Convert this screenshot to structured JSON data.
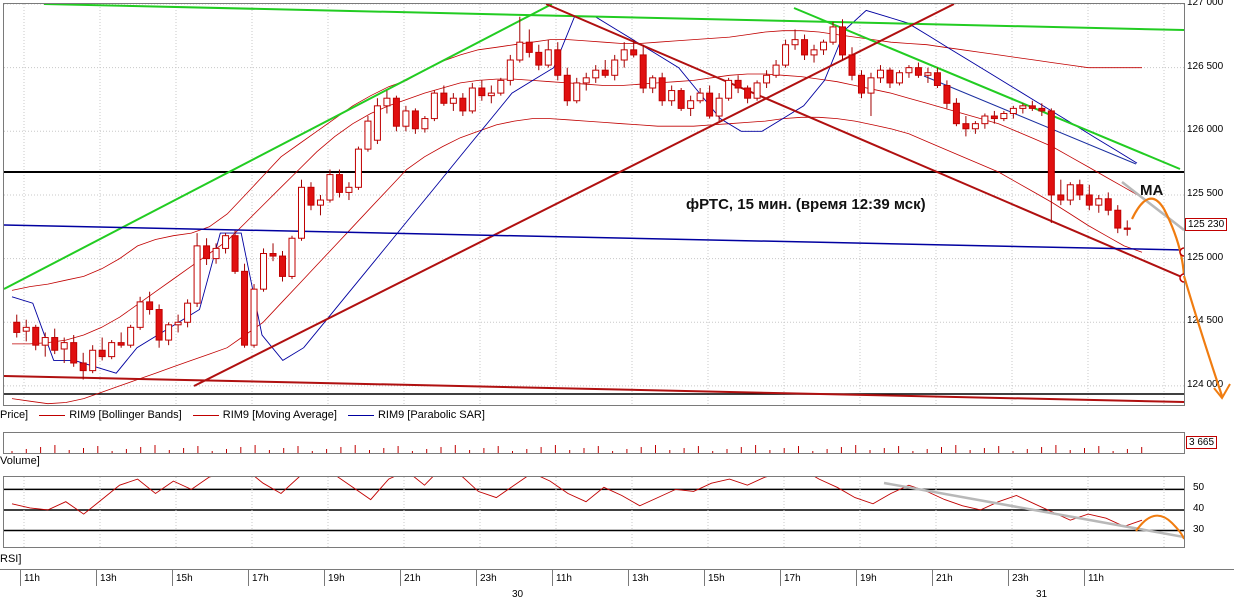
{
  "chart_data": {
    "type": "candlestick",
    "title": "фРТС,  15 мин. (время  12:39 мск)",
    "annotation_ma": "MA",
    "price_axis": {
      "ylim": [
        123850,
        127000
      ],
      "ticks": [
        "127 000",
        "126 500",
        "126 000",
        "125 500",
        "125 000",
        "124 500",
        "124 000"
      ],
      "tick_values": [
        127000,
        126500,
        126000,
        125500,
        125000,
        124500,
        124000
      ],
      "last_price_label": "125 230",
      "last_price": 125230
    },
    "legend": {
      "price": "Price]",
      "bollinger": "RIM9 [Bollinger Bands]",
      "ma": "RIM9 [Moving Average]",
      "sar": "RIM9 [Parabolic SAR]"
    },
    "volume": {
      "title": "Volume]",
      "last_label": "3 665"
    },
    "rsi": {
      "title": "RSI]",
      "ticks": [
        "50",
        "40",
        "30"
      ],
      "tick_values": [
        50,
        40,
        30
      ],
      "ylim": [
        22,
        56
      ]
    },
    "time_axis": {
      "hour_labels": [
        "11h",
        "13h",
        "15h",
        "17h",
        "19h",
        "21h",
        "23h",
        "11h",
        "13h",
        "15h",
        "17h",
        "19h",
        "21h",
        "23h",
        "11h"
      ],
      "date_labels": [
        "30",
        "31"
      ]
    },
    "candles": [
      [
        124500,
        124560,
        124380,
        124420
      ],
      [
        124430,
        124520,
        124350,
        124460
      ],
      [
        124460,
        124480,
        124280,
        124320
      ],
      [
        124320,
        124420,
        124230,
        124380
      ],
      [
        124380,
        124450,
        124250,
        124280
      ],
      [
        124290,
        124380,
        124180,
        124340
      ],
      [
        124340,
        124400,
        124150,
        124180
      ],
      [
        124180,
        124260,
        124050,
        124120
      ],
      [
        124120,
        124320,
        124100,
        124280
      ],
      [
        124280,
        124380,
        124200,
        124230
      ],
      [
        124230,
        124360,
        124210,
        124340
      ],
      [
        124340,
        124420,
        124300,
        124320
      ],
      [
        124320,
        124480,
        124300,
        124460
      ],
      [
        124460,
        124700,
        124440,
        124660
      ],
      [
        124660,
        124740,
        124560,
        124600
      ],
      [
        124600,
        124640,
        124300,
        124360
      ],
      [
        124360,
        124500,
        124320,
        124480
      ],
      [
        124480,
        124560,
        124420,
        124500
      ],
      [
        124500,
        124680,
        124460,
        124650
      ],
      [
        124650,
        125200,
        124620,
        125100
      ],
      [
        125100,
        125160,
        124950,
        125000
      ],
      [
        125000,
        125120,
        124960,
        125080
      ],
      [
        125080,
        125200,
        125040,
        125180
      ],
      [
        125180,
        125220,
        124880,
        124900
      ],
      [
        124900,
        124960,
        124300,
        124320
      ],
      [
        124320,
        124800,
        124300,
        124760
      ],
      [
        124760,
        125080,
        124740,
        125040
      ],
      [
        125040,
        125120,
        124980,
        125020
      ],
      [
        125020,
        125060,
        124820,
        124860
      ],
      [
        124860,
        125180,
        124840,
        125160
      ],
      [
        125160,
        125620,
        125140,
        125560
      ],
      [
        125560,
        125600,
        125380,
        125420
      ],
      [
        125420,
        125500,
        125340,
        125460
      ],
      [
        125460,
        125700,
        125440,
        125660
      ],
      [
        125660,
        125700,
        125480,
        125520
      ],
      [
        125520,
        125600,
        125460,
        125560
      ],
      [
        125560,
        125880,
        125540,
        125860
      ],
      [
        125860,
        126120,
        125840,
        126080
      ],
      [
        125930,
        126260,
        125900,
        126200
      ],
      [
        126200,
        126320,
        126140,
        126260
      ],
      [
        126260,
        126280,
        126000,
        126040
      ],
      [
        126040,
        126200,
        126000,
        126160
      ],
      [
        126160,
        126180,
        125980,
        126020
      ],
      [
        126020,
        126120,
        125990,
        126100
      ],
      [
        126100,
        126320,
        126080,
        126300
      ],
      [
        126300,
        126360,
        126200,
        126220
      ],
      [
        126220,
        126300,
        126160,
        126260
      ],
      [
        126260,
        126300,
        126120,
        126160
      ],
      [
        126160,
        126380,
        126140,
        126340
      ],
      [
        126340,
        126400,
        126240,
        126280
      ],
      [
        126280,
        126360,
        126220,
        126300
      ],
      [
        126300,
        126420,
        126280,
        126400
      ],
      [
        126400,
        126600,
        126360,
        126560
      ],
      [
        126560,
        126900,
        126540,
        126700
      ],
      [
        126700,
        126800,
        126580,
        126620
      ],
      [
        126620,
        126680,
        126480,
        126520
      ],
      [
        126520,
        126720,
        126500,
        126640
      ],
      [
        126640,
        126700,
        126400,
        126440
      ],
      [
        126440,
        126500,
        126200,
        126240
      ],
      [
        126240,
        126420,
        126220,
        126380
      ],
      [
        126380,
        126460,
        126320,
        126420
      ],
      [
        126420,
        126520,
        126380,
        126480
      ],
      [
        126480,
        126560,
        126420,
        126440
      ],
      [
        126440,
        126600,
        126400,
        126560
      ],
      [
        126560,
        126700,
        126500,
        126640
      ],
      [
        126640,
        126720,
        126580,
        126600
      ],
      [
        126600,
        126680,
        126300,
        126340
      ],
      [
        126340,
        126440,
        126300,
        126420
      ],
      [
        126420,
        126460,
        126200,
        126240
      ],
      [
        126240,
        126360,
        126200,
        126320
      ],
      [
        126320,
        126340,
        126160,
        126180
      ],
      [
        126180,
        126280,
        126120,
        126240
      ],
      [
        126240,
        126340,
        126220,
        126300
      ],
      [
        126300,
        126360,
        126100,
        126120
      ],
      [
        126120,
        126300,
        126080,
        126260
      ],
      [
        126260,
        126420,
        126240,
        126400
      ],
      [
        126400,
        126440,
        126300,
        126340
      ],
      [
        126340,
        126360,
        126220,
        126260
      ],
      [
        126260,
        126400,
        126240,
        126380
      ],
      [
        126380,
        126480,
        126340,
        126440
      ],
      [
        126440,
        126560,
        126420,
        126520
      ],
      [
        126520,
        126720,
        126500,
        126680
      ],
      [
        126680,
        126800,
        126640,
        126720
      ],
      [
        126720,
        126760,
        126560,
        126600
      ],
      [
        126600,
        126680,
        126540,
        126640
      ],
      [
        126640,
        126720,
        126600,
        126700
      ],
      [
        126700,
        126860,
        126680,
        126820
      ],
      [
        126820,
        126880,
        126560,
        126600
      ],
      [
        126600,
        126660,
        126400,
        126440
      ],
      [
        126440,
        126480,
        126260,
        126300
      ],
      [
        126300,
        126460,
        126120,
        126420
      ],
      [
        126420,
        126520,
        126380,
        126480
      ],
      [
        126480,
        126500,
        126340,
        126380
      ],
      [
        126380,
        126480,
        126360,
        126460
      ],
      [
        126460,
        126520,
        126420,
        126500
      ],
      [
        126500,
        126540,
        126420,
        126440
      ],
      [
        126440,
        126500,
        126380,
        126460
      ],
      [
        126460,
        126500,
        126340,
        126360
      ],
      [
        126360,
        126400,
        126180,
        126220
      ],
      [
        126220,
        126260,
        126040,
        126060
      ],
      [
        126060,
        126120,
        125960,
        126020
      ],
      [
        126020,
        126080,
        125980,
        126060
      ],
      [
        126060,
        126140,
        126020,
        126120
      ],
      [
        126120,
        126160,
        126060,
        126100
      ],
      [
        126100,
        126160,
        126080,
        126140
      ],
      [
        126140,
        126200,
        126100,
        126180
      ],
      [
        126180,
        126220,
        126140,
        126200
      ],
      [
        126200,
        126240,
        126160,
        126180
      ],
      [
        126180,
        126220,
        126120,
        126160
      ],
      [
        126160,
        126180,
        125280,
        125500
      ],
      [
        125500,
        125620,
        125420,
        125460
      ],
      [
        125460,
        125600,
        125420,
        125580
      ],
      [
        125580,
        125620,
        125460,
        125500
      ],
      [
        125500,
        125580,
        125380,
        125420
      ],
      [
        125420,
        125500,
        125360,
        125470
      ],
      [
        125470,
        125520,
        125340,
        125380
      ],
      [
        125380,
        125420,
        125200,
        125240
      ],
      [
        125240,
        125300,
        125180,
        125230
      ]
    ],
    "bollinger_upper": [
      124750,
      124780,
      124800,
      124830,
      124860,
      124920,
      125000,
      125100,
      125150,
      125180,
      125200,
      125250,
      125350,
      125500,
      125650,
      125800,
      125900,
      126000,
      126100,
      126200,
      126280,
      126350,
      126400,
      126480,
      126550,
      126600,
      126640,
      126660,
      126680,
      126700,
      126720,
      126720,
      126710,
      126700,
      126690,
      126690,
      126700,
      126710,
      126720,
      126730,
      126740,
      126760,
      126780,
      126790,
      126790,
      126780,
      126760,
      126740,
      126720,
      126700,
      126690,
      126680,
      126660,
      126640,
      126620,
      126600,
      126580,
      126560,
      126540,
      126520,
      126500,
      126500,
      126500,
      126500
    ],
    "bollinger_lower": [
      123900,
      123880,
      123860,
      123870,
      123900,
      123950,
      124000,
      124050,
      124100,
      124150,
      124200,
      124250,
      124300,
      124400,
      124500,
      124650,
      124800,
      124950,
      125100,
      125250,
      125400,
      125550,
      125700,
      125800,
      125880,
      125950,
      126000,
      126050,
      126080,
      126100,
      126100,
      126090,
      126080,
      126070,
      126060,
      126050,
      126040,
      126040,
      126040,
      126050,
      126060,
      126070,
      126080,
      126100,
      126110,
      126110,
      126100,
      126080,
      126050,
      126020,
      125980,
      125920,
      125860,
      125800,
      125740,
      125680,
      125600,
      125520,
      125440,
      125350,
      125260,
      125180,
      125100,
      125050
    ],
    "moving_average": [
      124330,
      124330,
      124340,
      124360,
      124400,
      124460,
      124540,
      124640,
      124740,
      124840,
      124940,
      125040,
      125140,
      125280,
      125420,
      125560,
      125700,
      125840,
      125960,
      126060,
      126140,
      126200,
      126250,
      126300,
      126340,
      126380,
      126400,
      126410,
      126410,
      126400,
      126390,
      126380,
      126370,
      126360,
      126360,
      126370,
      126380,
      126390,
      126400,
      126420,
      126440,
      126450,
      126450,
      126440,
      126430,
      126410,
      126390,
      126360,
      126330,
      126300,
      126260,
      126220,
      126180,
      126140,
      126100,
      126060,
      126000,
      125940,
      125880,
      125800,
      125720,
      125640,
      125560,
      125480
    ],
    "parabolic_sar": [
      124700,
      124650,
      124200,
      124200,
      124150,
      124100,
      124300,
      124400,
      124500,
      124600,
      125200,
      125200,
      124400,
      124200,
      124300,
      124500,
      124700,
      124900,
      125100,
      125300,
      125500,
      125700,
      125900,
      126100,
      126300,
      126400,
      126500,
      126900,
      126900,
      126800,
      126700,
      126600,
      126500,
      126300,
      126100,
      126000,
      126000,
      126100,
      126200,
      126400,
      126800,
      126950,
      126900,
      126850,
      126750,
      126650,
      126550,
      126450,
      126350,
      126250,
      126150,
      126050,
      125950,
      125850,
      125750
    ],
    "rsi_values": [
      43,
      41,
      40,
      44,
      38,
      45,
      52,
      55,
      48,
      54,
      50,
      56,
      58,
      60,
      53,
      48,
      56,
      62,
      57,
      51,
      45,
      55,
      59,
      52,
      61,
      57,
      49,
      46,
      52,
      58,
      54,
      48,
      44,
      51,
      47,
      42,
      46,
      50,
      49,
      53,
      55,
      52,
      56,
      58,
      60,
      55,
      51,
      46,
      43,
      48,
      52,
      49,
      45,
      42,
      40,
      44,
      47,
      43,
      39,
      35,
      38,
      36,
      32,
      35
    ]
  }
}
